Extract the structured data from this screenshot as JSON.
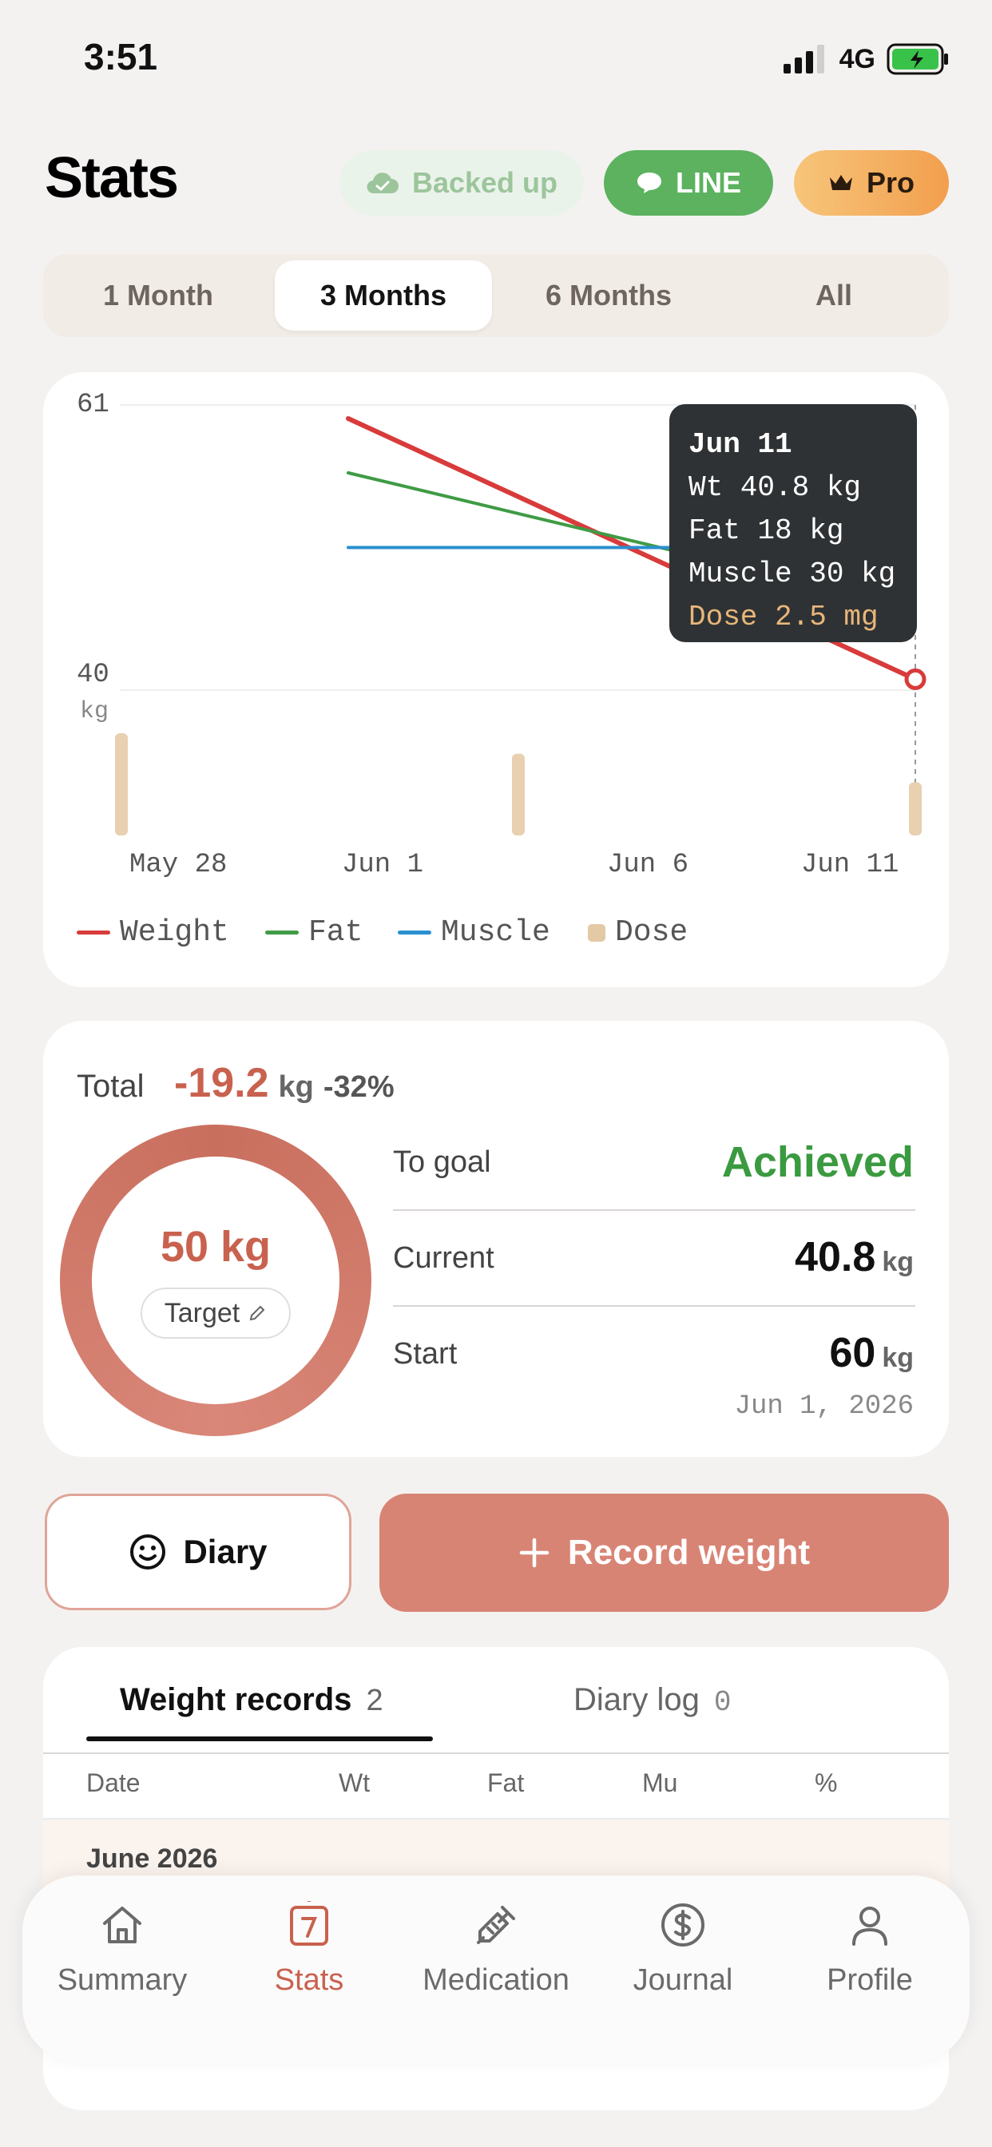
{
  "status_bar": {
    "time": "3:51",
    "network": "4G"
  },
  "header": {
    "title": "Stats",
    "backed_up_label": "Backed up",
    "line_label": "LINE",
    "pro_label": "Pro"
  },
  "range_tabs": {
    "items": [
      "1 Month",
      "3 Months",
      "6 Months",
      "All"
    ],
    "selected": "3 Months"
  },
  "chart_data": {
    "type": "line",
    "y_ticks": [
      "61",
      "40"
    ],
    "y_unit": "kg",
    "ylim": [
      40,
      61
    ],
    "x_ticks": [
      "May 28",
      "Jun 1",
      "Jun 6",
      "Jun 11"
    ],
    "series": [
      {
        "name": "Weight",
        "color": "#d83b3b",
        "points": [
          [
            "Jun 1",
            60
          ],
          [
            "Jun 11",
            40.8
          ]
        ]
      },
      {
        "name": "Fat",
        "color": "#3f9b45",
        "points": [
          [
            "Jun 1",
            56
          ],
          [
            "Jun 11",
            46
          ]
        ]
      },
      {
        "name": "Muscle",
        "color": "#2a8fd0",
        "points": [
          [
            "Jun 1",
            50.5
          ],
          [
            "Jun 11",
            50.5
          ]
        ]
      }
    ],
    "dose_series": {
      "name": "Dose",
      "color": "#e8d0b0",
      "points": [
        [
          "May 28",
          2.5
        ],
        [
          "Jun 4",
          2.0
        ],
        [
          "Jun 11",
          1.3
        ]
      ]
    },
    "tooltip": {
      "date": "Jun 11",
      "weight": "Wt 40.8 kg",
      "fat": "Fat 18 kg",
      "muscle": "Muscle 30 kg",
      "dose": "Dose 2.5 mg"
    },
    "legend": [
      "Weight",
      "Fat",
      "Muscle",
      "Dose"
    ]
  },
  "summary": {
    "total_label": "Total",
    "total_value": "-19.2",
    "total_unit": "kg",
    "total_percent": "-32%",
    "target_value": "50 kg",
    "target_label": "Target",
    "to_goal_label": "To goal",
    "to_goal_value": "Achieved",
    "current_label": "Current",
    "current_value": "40.8",
    "current_unit": "kg",
    "start_label": "Start",
    "start_value": "60",
    "start_unit": "kg",
    "start_date": "Jun 1, 2026",
    "colors": {
      "accent": "#c9614f",
      "achieved": "#3a9a3f"
    }
  },
  "actions": {
    "diary_label": "Diary",
    "record_label": "Record weight"
  },
  "records": {
    "tabs": [
      {
        "label": "Weight records",
        "count": "2"
      },
      {
        "label": "Diary log",
        "count": "0"
      }
    ],
    "columns": [
      "Date",
      "Wt",
      "Fat",
      "Mu",
      "%"
    ],
    "month_label": "June 2026"
  },
  "bottom_nav": {
    "items": [
      {
        "label": "Summary",
        "icon": "home-icon"
      },
      {
        "label": "Stats",
        "icon": "calendar-icon"
      },
      {
        "label": "Medication",
        "icon": "syringe-icon"
      },
      {
        "label": "Journal",
        "icon": "dollar-icon"
      },
      {
        "label": "Profile",
        "icon": "person-icon"
      }
    ],
    "active": "Stats"
  }
}
